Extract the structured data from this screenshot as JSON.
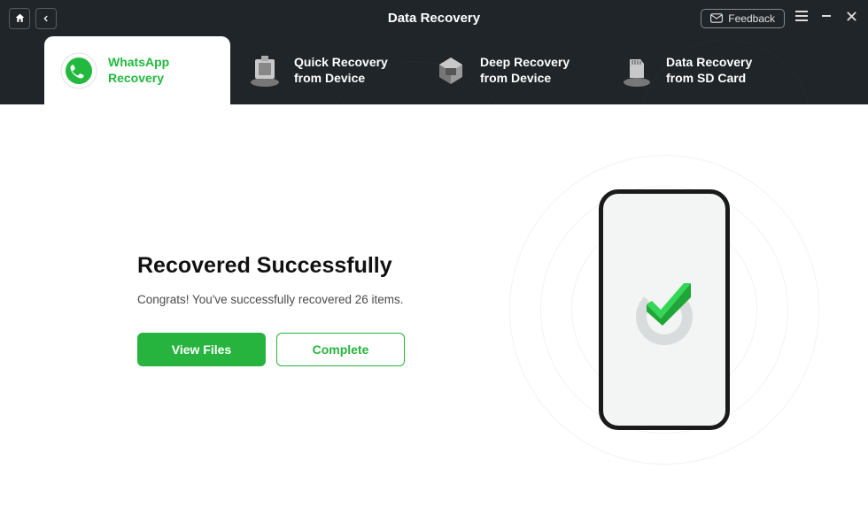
{
  "header": {
    "title": "Data Recovery",
    "feedback_label": "Feedback"
  },
  "tabs": [
    {
      "line1": "WhatsApp",
      "line2": "Recovery"
    },
    {
      "line1": "Quick Recovery",
      "line2": "from Device"
    },
    {
      "line1": "Deep Recovery",
      "line2": "from Device"
    },
    {
      "line1": "Data Recovery",
      "line2": "from SD Card"
    }
  ],
  "result": {
    "title": "Recovered Successfully",
    "subtitle": "Congrats! You've successfully recovered 26 items.",
    "view_label": "View Files",
    "complete_label": "Complete"
  }
}
